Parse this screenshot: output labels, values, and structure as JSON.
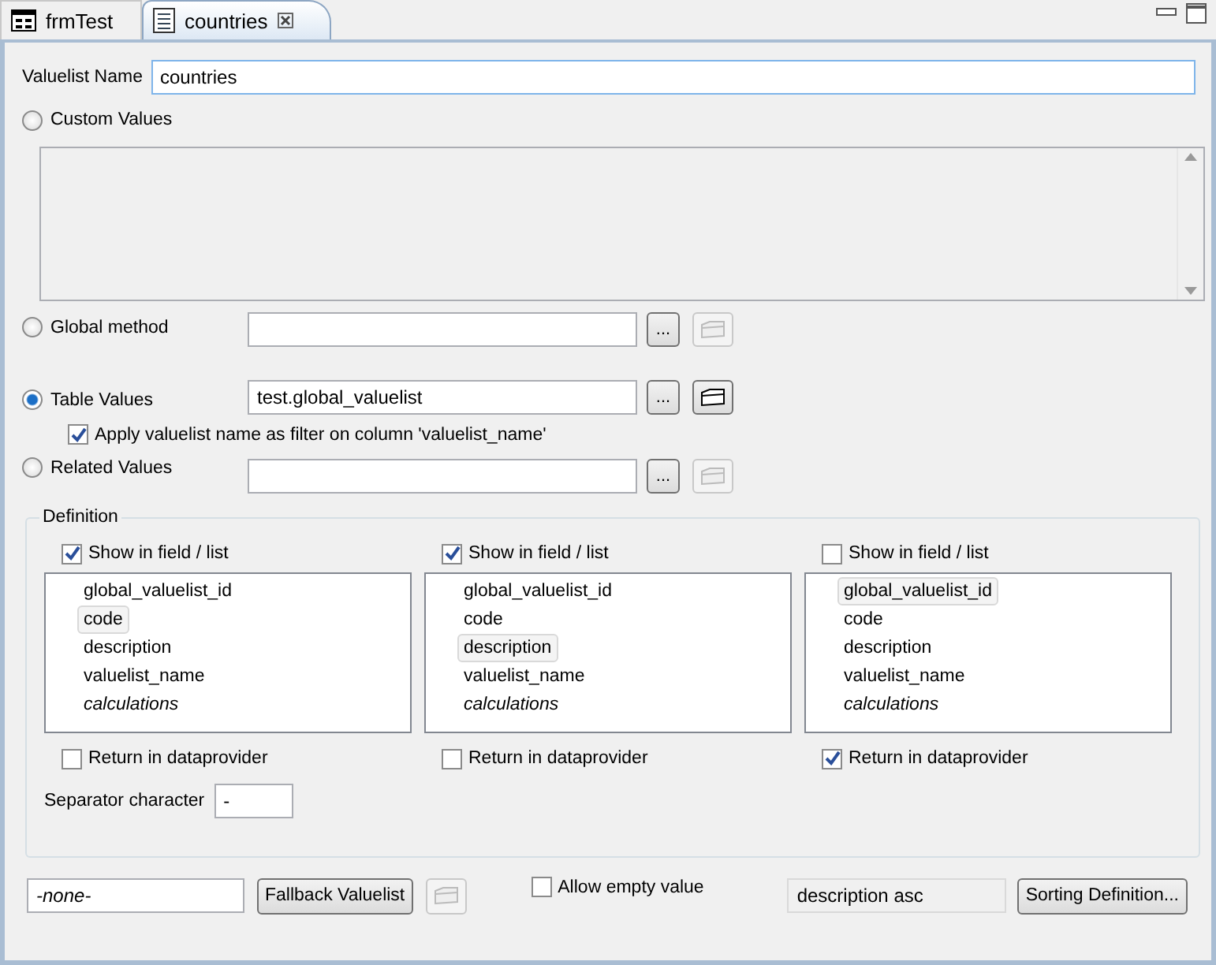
{
  "tabs": [
    {
      "label": "frmTest",
      "selected": false,
      "kind": "form"
    },
    {
      "label": "countries",
      "selected": true,
      "kind": "list",
      "closable": true
    }
  ],
  "valuelist_name": {
    "label": "Valuelist Name",
    "value": "countries"
  },
  "sources": [
    {
      "kind": "custom",
      "label": "Custom Values",
      "selected": false
    },
    {
      "kind": "method",
      "label": "Global method",
      "selected": false,
      "browse": "...",
      "open_disabled": true
    },
    {
      "kind": "table",
      "label": "Table Values",
      "selected": true,
      "value": "test.global_valuelist",
      "browse": "...",
      "open_disabled": false,
      "filter": {
        "label": "Apply valuelist name as filter on column 'valuelist_name'",
        "checked": true
      }
    },
    {
      "kind": "related",
      "label": "Related Values",
      "selected": false,
      "browse": "...",
      "open_disabled": true
    }
  ],
  "definition": {
    "title": "Definition",
    "columns": [
      {
        "show": {
          "label": "Show in field / list",
          "checked": true
        },
        "items": [
          {
            "label": "global_valuelist_id",
            "kind": "column",
            "selected": false
          },
          {
            "label": "code",
            "kind": "column",
            "selected": true
          },
          {
            "label": "description",
            "kind": "column",
            "selected": false
          },
          {
            "label": "valuelist_name",
            "kind": "column",
            "selected": false
          },
          {
            "label": "calculations",
            "kind": "calculations",
            "selected": false
          }
        ],
        "return": {
          "label": "Return in dataprovider",
          "checked": false
        }
      },
      {
        "show": {
          "label": "Show in field / list",
          "checked": true
        },
        "items": [
          {
            "label": "global_valuelist_id",
            "kind": "column",
            "selected": false
          },
          {
            "label": "code",
            "kind": "column",
            "selected": false
          },
          {
            "label": "description",
            "kind": "column",
            "selected": true
          },
          {
            "label": "valuelist_name",
            "kind": "column",
            "selected": false
          },
          {
            "label": "calculations",
            "kind": "calculations",
            "selected": false
          }
        ],
        "return": {
          "label": "Return in dataprovider",
          "checked": false
        }
      },
      {
        "show": {
          "label": "Show in field / list",
          "checked": false
        },
        "items": [
          {
            "label": "global_valuelist_id",
            "kind": "column",
            "selected": true
          },
          {
            "label": "code",
            "kind": "column",
            "selected": false
          },
          {
            "label": "description",
            "kind": "column",
            "selected": false
          },
          {
            "label": "valuelist_name",
            "kind": "column",
            "selected": false
          },
          {
            "label": "calculations",
            "kind": "calculations",
            "selected": false
          }
        ],
        "return": {
          "label": "Return in dataprovider",
          "checked": true
        }
      }
    ],
    "separator": {
      "label": "Separator character",
      "value": "-"
    }
  },
  "footer": {
    "fallback_value": "-none-",
    "fallback_button": "Fallback Valuelist",
    "open_disabled": true,
    "allow_empty": {
      "label": "Allow empty value",
      "checked": false
    },
    "sorting_value": "description asc",
    "sorting_button": "Sorting Definition..."
  }
}
